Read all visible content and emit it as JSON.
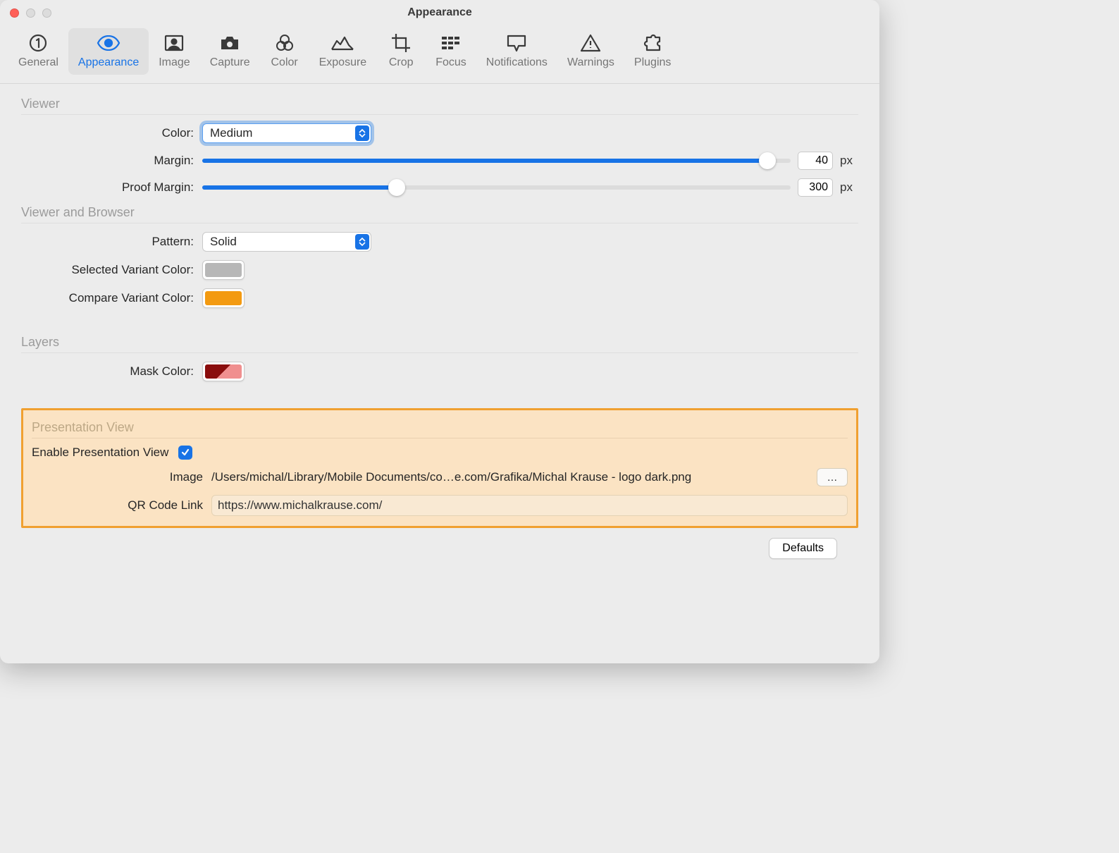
{
  "window": {
    "title": "Appearance"
  },
  "toolbar": {
    "items": [
      {
        "label": "General",
        "icon": "one-circle-icon"
      },
      {
        "label": "Appearance",
        "icon": "eye-icon"
      },
      {
        "label": "Image",
        "icon": "portrait-icon"
      },
      {
        "label": "Capture",
        "icon": "camera-icon"
      },
      {
        "label": "Color",
        "icon": "rings-icon"
      },
      {
        "label": "Exposure",
        "icon": "histogram-icon"
      },
      {
        "label": "Crop",
        "icon": "crop-icon"
      },
      {
        "label": "Focus",
        "icon": "grid-icon"
      },
      {
        "label": "Notifications",
        "icon": "chat-icon"
      },
      {
        "label": "Warnings",
        "icon": "warning-icon"
      },
      {
        "label": "Plugins",
        "icon": "puzzle-icon"
      }
    ],
    "active_index": 1
  },
  "sections": {
    "viewer": {
      "title": "Viewer",
      "color_label": "Color:",
      "color_value": "Medium",
      "margin_label": "Margin:",
      "margin_value": "40",
      "margin_unit": "px",
      "margin_fill_pct": 96,
      "proof_label": "Proof Margin:",
      "proof_value": "300",
      "proof_unit": "px",
      "proof_fill_pct": 33
    },
    "viewer_browser": {
      "title": "Viewer and Browser",
      "pattern_label": "Pattern:",
      "pattern_value": "Solid",
      "selected_variant_label": "Selected Variant Color:",
      "selected_variant_hex": "#b7b7b7",
      "compare_variant_label": "Compare Variant Color:",
      "compare_variant_hex": "#f39a11"
    },
    "layers": {
      "title": "Layers",
      "mask_label": "Mask Color:"
    },
    "presentation": {
      "title": "Presentation View",
      "enable_label": "Enable Presentation View",
      "enable_checked": true,
      "image_label": "Image",
      "image_path": "/Users/michal/Library/Mobile Documents/co…e.com/Grafika/Michal Krause - logo dark.png",
      "browse_label": "…",
      "qr_label": "QR Code Link",
      "qr_value": "https://www.michalkrause.com/"
    }
  },
  "footer": {
    "defaults_label": "Defaults"
  }
}
